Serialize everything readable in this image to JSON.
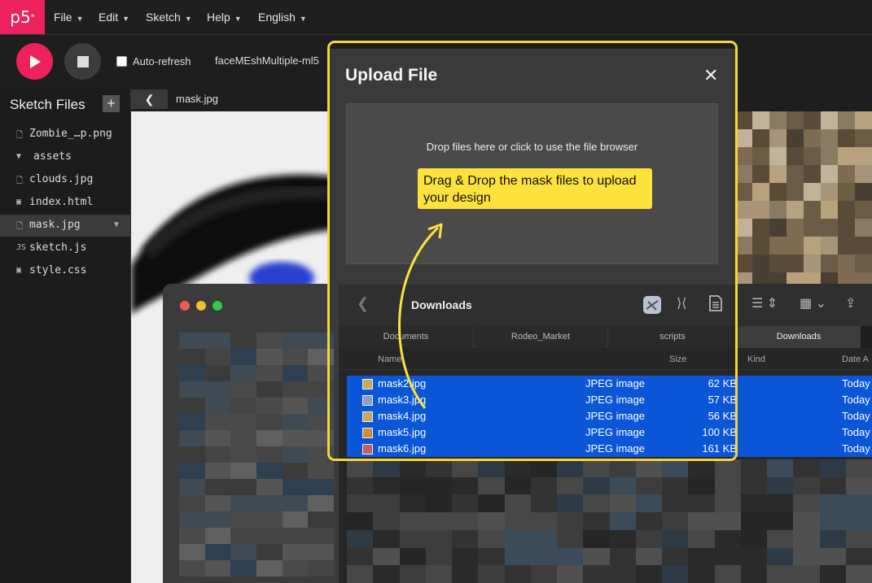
{
  "app": {
    "logo": "p5",
    "logo_sup": "*"
  },
  "menu": [
    {
      "label": "File"
    },
    {
      "label": "Edit"
    },
    {
      "label": "Sketch"
    },
    {
      "label": "Help"
    },
    {
      "label": "English"
    }
  ],
  "toolbar": {
    "auto_refresh_label": "Auto-refresh",
    "auto_refresh_checked": false,
    "sketch_name": "faceMEshMultiple-ml5"
  },
  "sidebar": {
    "title": "Sketch Files",
    "add_icon": "+",
    "files": [
      {
        "name": "Zombie_…p.png",
        "icon": "file-icon"
      },
      {
        "name": "assets",
        "icon": "folder-open-icon"
      },
      {
        "name": "clouds.jpg",
        "icon": "file-icon"
      },
      {
        "name": "index.html",
        "icon": "html-icon"
      },
      {
        "name": "mask.jpg",
        "icon": "file-icon",
        "selected": true
      },
      {
        "name": "sketch.js",
        "icon": "js-icon"
      },
      {
        "name": "style.css",
        "icon": "css-icon"
      }
    ]
  },
  "editor": {
    "back_icon": "chevron-left-icon",
    "file_title": "mask.jpg"
  },
  "modal": {
    "title": "Upload File",
    "close_icon": "close-icon",
    "drop_text": "Drop files here or click to use the file browser",
    "callout": "Drag & Drop the mask files to upload your design",
    "highlight_color": "#f5d53a"
  },
  "finder": {
    "title": "Downloads",
    "path_tabs": [
      {
        "label": "Documents"
      },
      {
        "label": "Rodeo_Market"
      },
      {
        "label": "scripts"
      },
      {
        "label": "Downloads",
        "active": true
      }
    ],
    "columns": {
      "name": "Name",
      "size": "Size",
      "kind": "Kind",
      "date": "Date A"
    },
    "files": [
      {
        "name": "mask2.jpg",
        "size": "62 KB",
        "kind": "JPEG image",
        "date": "Today"
      },
      {
        "name": "mask3.jpg",
        "size": "57 KB",
        "kind": "JPEG image",
        "date": "Today"
      },
      {
        "name": "mask4.jpg",
        "size": "56 KB",
        "kind": "JPEG image",
        "date": "Today"
      },
      {
        "name": "mask5.jpg",
        "size": "100 KB",
        "kind": "JPEG image",
        "date": "Today"
      },
      {
        "name": "mask6.jpg",
        "size": "161 KB",
        "kind": "JPEG image",
        "date": "Today"
      }
    ]
  },
  "colors": {
    "accent": "#ed225d",
    "selection": "#0a56d6",
    "callout": "#fde13d"
  }
}
